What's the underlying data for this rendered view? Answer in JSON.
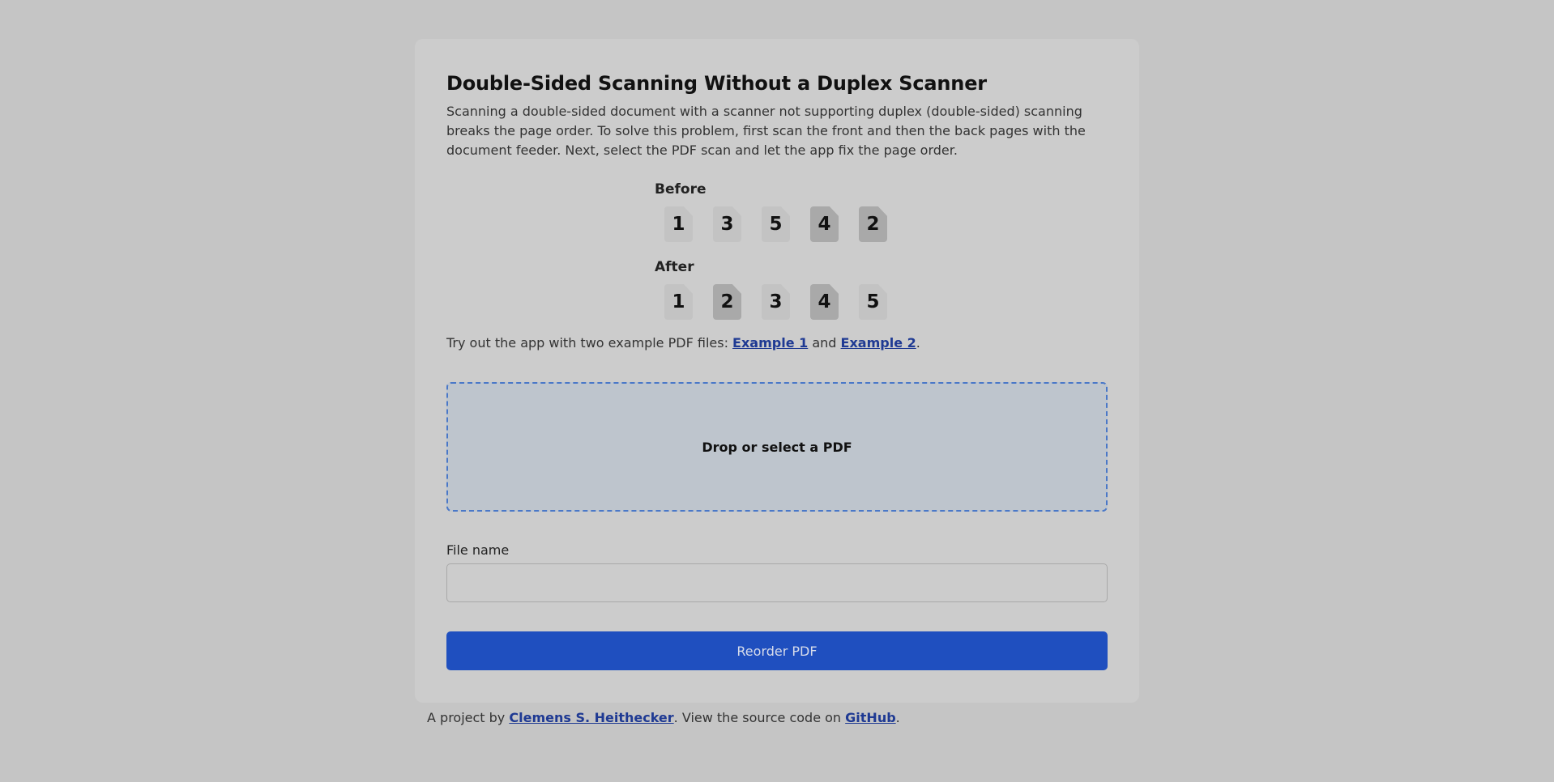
{
  "header": {
    "title": "Double-Sided Scanning Without a Duplex Scanner"
  },
  "intro": "Scanning a double-sided document with a scanner not supporting duplex (double-sided) scanning breaks the page order. To solve this problem, first scan the front and then the back pages with the document feeder. Next, select the PDF scan and let the app fix the page order.",
  "before": {
    "label": "Before",
    "pages": [
      "1",
      "3",
      "5",
      "4",
      "2"
    ]
  },
  "after": {
    "label": "After",
    "pages": [
      "1",
      "2",
      "3",
      "4",
      "5"
    ]
  },
  "examples": {
    "prefix": "Try out the app with two example PDF files: ",
    "link1": "Example 1",
    "middle": " and ",
    "link2": "Example 2",
    "suffix": "."
  },
  "dropzone": {
    "label": "Drop or select a PDF"
  },
  "file_name": {
    "label": "File name",
    "value": ""
  },
  "reorder_button": {
    "label": "Reorder PDF"
  },
  "footer": {
    "prefix": "A project by ",
    "author": "Clemens S. Heithecker",
    "middle": ". View the source code on ",
    "github": "GitHub",
    "suffix": "."
  },
  "colors": {
    "background": "#c5c5c5",
    "card": "#cccccc",
    "accent": "#1f4fbf",
    "link": "#1f3a93",
    "front_page": "#c3c3c3",
    "back_page": "#a9a9a9",
    "dropzone_border": "#4a78c8"
  }
}
